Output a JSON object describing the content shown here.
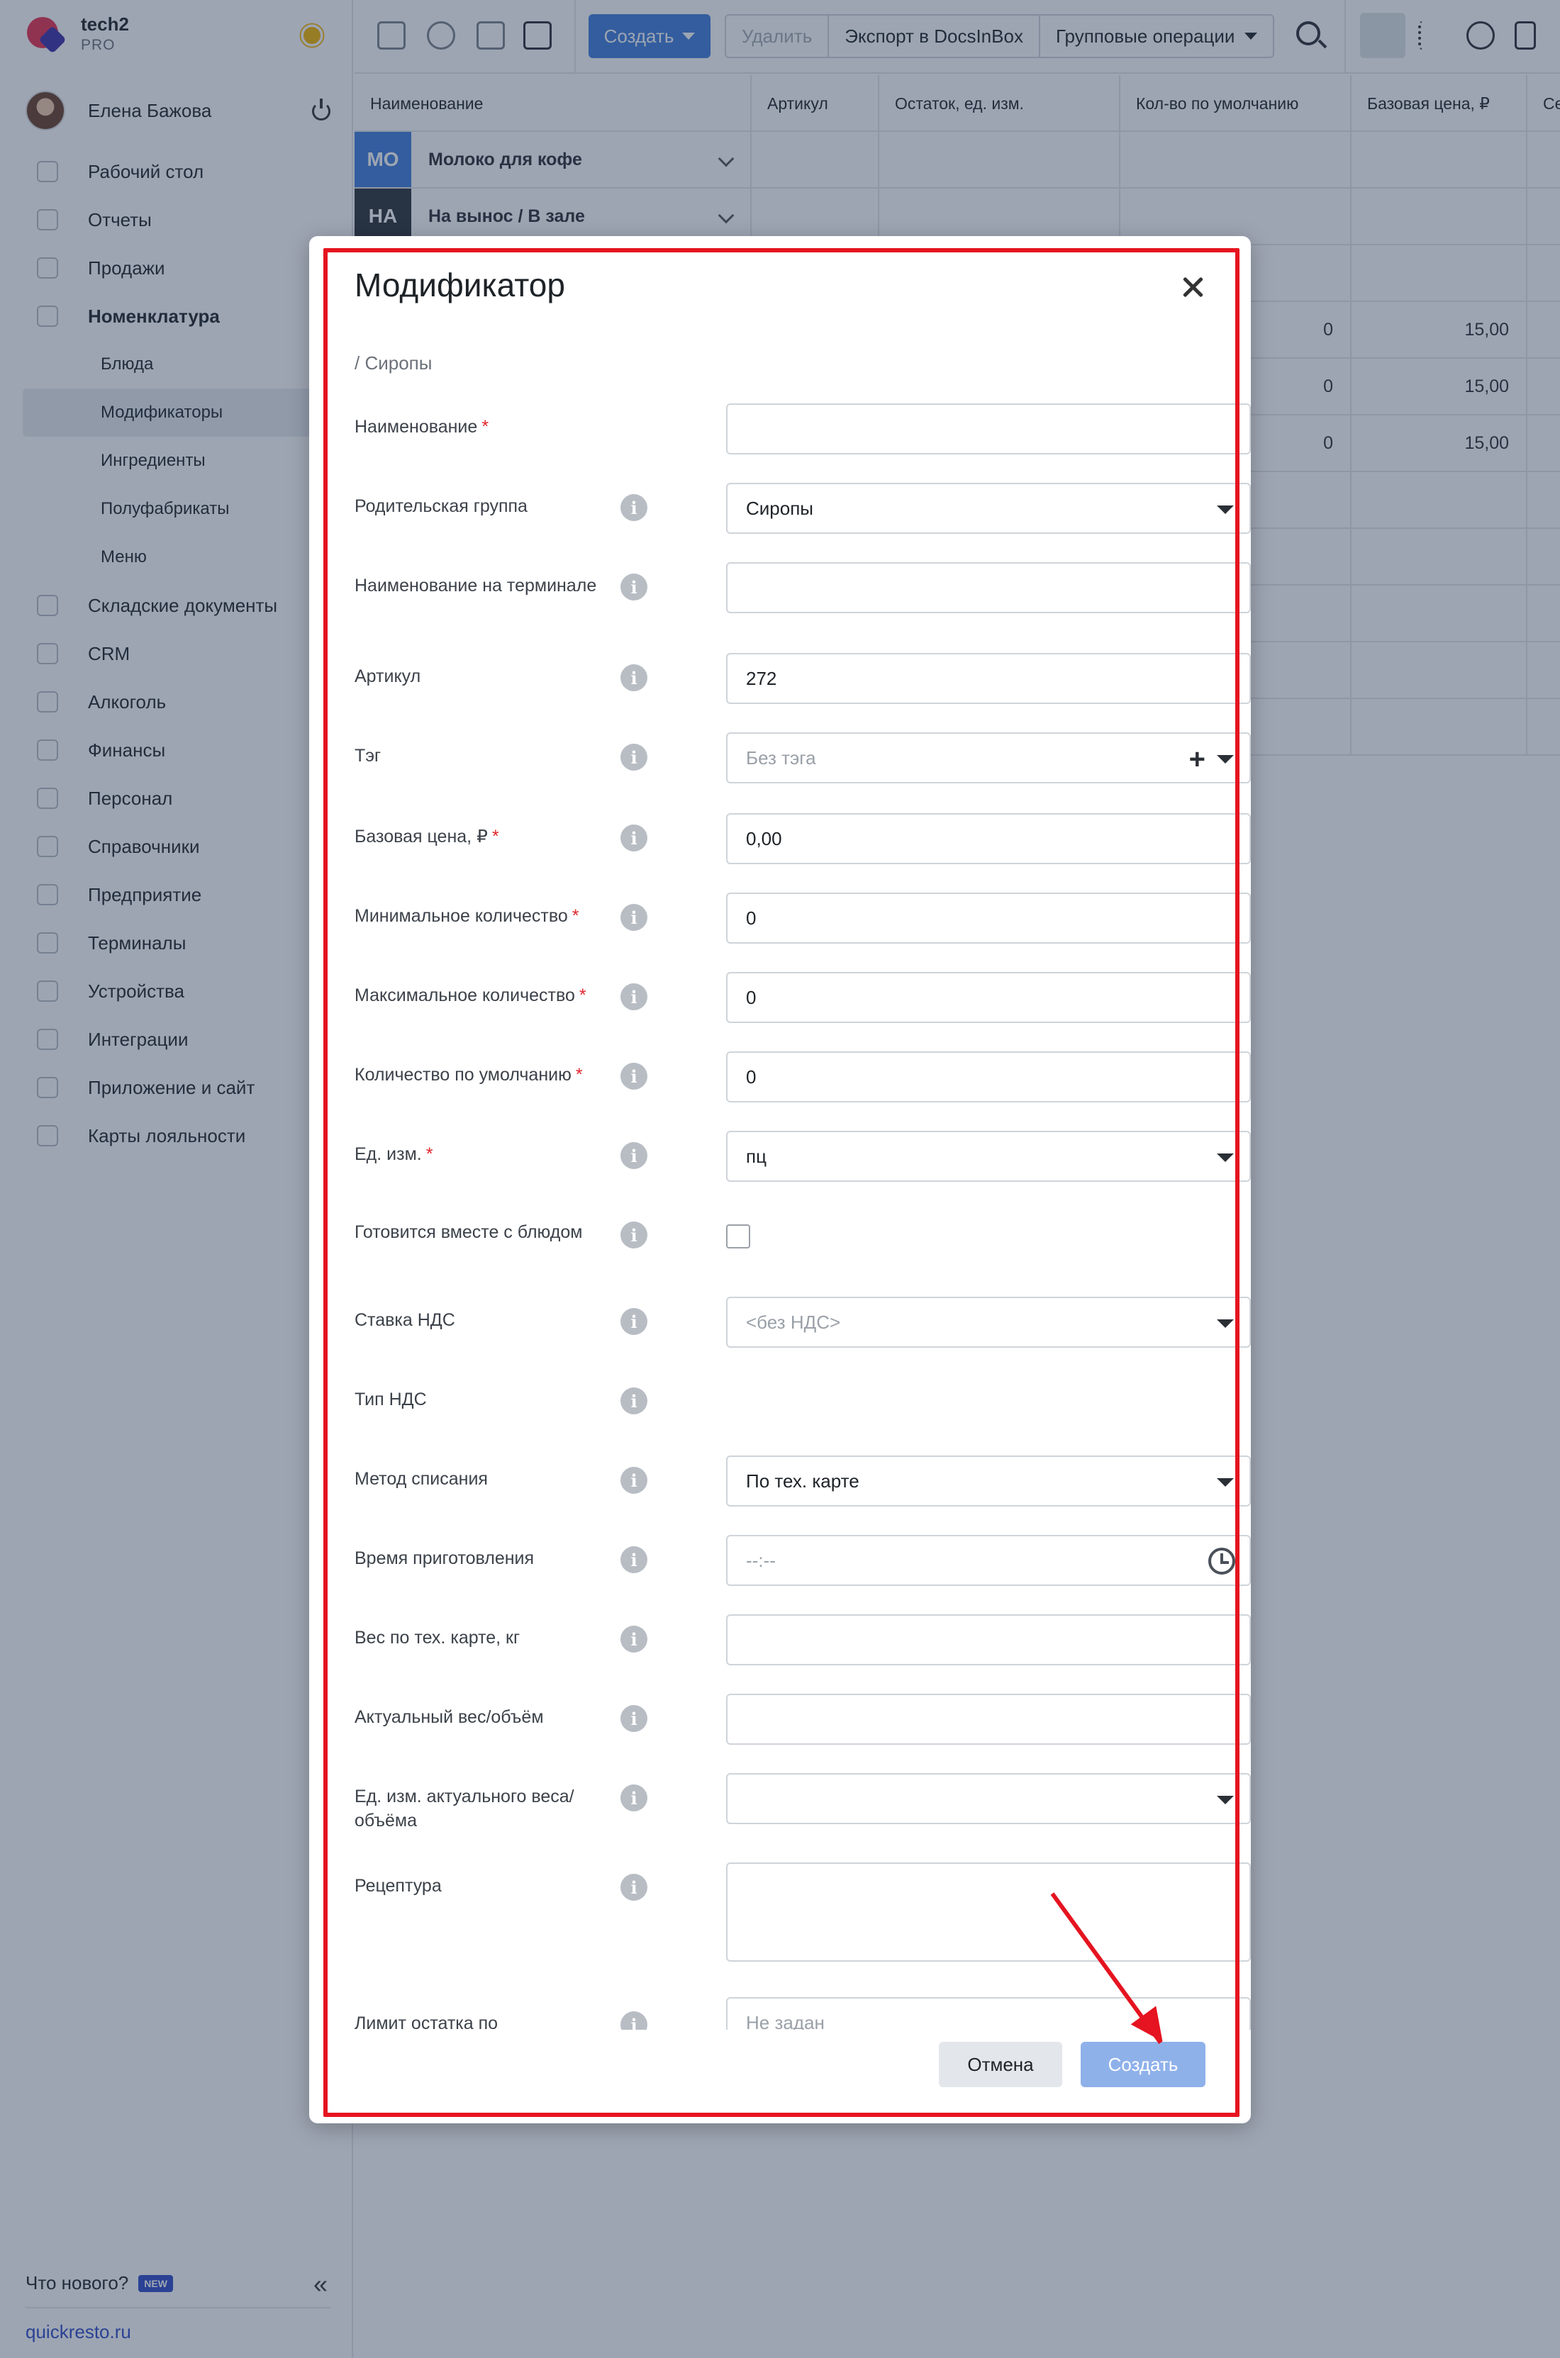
{
  "app": {
    "name": "tech2",
    "plan": "PRO",
    "user_name": "Елена Бажова"
  },
  "sidebar": {
    "items": [
      {
        "label": "Рабочий стол"
      },
      {
        "label": "Отчеты"
      },
      {
        "label": "Продажи"
      },
      {
        "label": "Номенклатура"
      },
      {
        "label": "Блюда"
      },
      {
        "label": "Модификаторы"
      },
      {
        "label": "Ингредиенты"
      },
      {
        "label": "Полуфабрикаты"
      },
      {
        "label": "Меню"
      },
      {
        "label": "Складские документы"
      },
      {
        "label": "CRM"
      },
      {
        "label": "Алкоголь"
      },
      {
        "label": "Финансы"
      },
      {
        "label": "Персонал"
      },
      {
        "label": "Справочники"
      },
      {
        "label": "Предприятие"
      },
      {
        "label": "Терминалы"
      },
      {
        "label": "Устройства"
      },
      {
        "label": "Интеграции"
      },
      {
        "label": "Приложение и сайт"
      },
      {
        "label": "Карты лояльности"
      }
    ],
    "whats_new": "Что нового?",
    "new_badge": "NEW",
    "site_link": "quickresto.ru"
  },
  "toolbar": {
    "create": "Создать",
    "delete": "Удалить",
    "export": "Экспорт в DocsInBox",
    "group_ops": "Групповые операции"
  },
  "table": {
    "columns": [
      "Наименование",
      "Артикул",
      "Остаток, ед. изм.",
      "Кол-во по умолчанию",
      "Базовая цена, ₽",
      "Се"
    ],
    "groups": [
      {
        "badge": "МО",
        "name": "Молоко для кофе",
        "color": "#3f7ddb"
      },
      {
        "badge": "НА",
        "name": "На вынос / В зале",
        "color": "#2b3038"
      }
    ],
    "rows": [
      {
        "default_qty": "0",
        "price": "15,00"
      },
      {
        "default_qty": "0",
        "price": "15,00"
      },
      {
        "default_qty": "0",
        "price": "15,00"
      }
    ]
  },
  "modal": {
    "title": "Модификатор",
    "breadcrumb": "/ Сиропы",
    "fields": {
      "name": {
        "label": "Наименование",
        "value": ""
      },
      "parent_group": {
        "label": "Родительская группа",
        "value": "Сиропы"
      },
      "terminal_name": {
        "label": "Наименование на терминале",
        "value": ""
      },
      "article": {
        "label": "Артикул",
        "value": "272"
      },
      "tag": {
        "label": "Тэг",
        "placeholder": "Без тэга"
      },
      "base_price": {
        "label": "Базовая цена, ₽",
        "value": "0,00"
      },
      "min_qty": {
        "label": "Минимальное количество",
        "value": "0"
      },
      "max_qty": {
        "label": "Максимальное количество",
        "value": "0"
      },
      "default_qty": {
        "label": "Количество по умолчанию",
        "value": "0"
      },
      "unit": {
        "label": "Ед. изм.",
        "value": "пц"
      },
      "cooked_with_dish": {
        "label": "Готовится вместе с блюдом",
        "checked": false
      },
      "vat_rate": {
        "label": "Ставка НДС",
        "placeholder": "<без НДС>"
      },
      "vat_type": {
        "label": "Тип НДС"
      },
      "writeoff_method": {
        "label": "Метод списания",
        "value": "По тех. карте"
      },
      "cooking_time": {
        "label": "Время приготовления",
        "placeholder": "--:--"
      },
      "tech_weight": {
        "label": "Вес по тех. карте, кг",
        "value": ""
      },
      "actual_weight": {
        "label": "Актуальный вес/объём",
        "value": ""
      },
      "actual_weight_unit": {
        "label": "Ед. изм. актуального веса/объёма",
        "value": ""
      },
      "recipe": {
        "label": "Рецептура",
        "value": ""
      },
      "stock_limit": {
        "label": "Лимит остатка по",
        "placeholder": "Не задан"
      }
    },
    "cancel": "Отмена",
    "submit": "Создать"
  },
  "colors": {
    "accent": "#3f7ddb",
    "highlight": "#e51420",
    "required": "#e0262b"
  }
}
